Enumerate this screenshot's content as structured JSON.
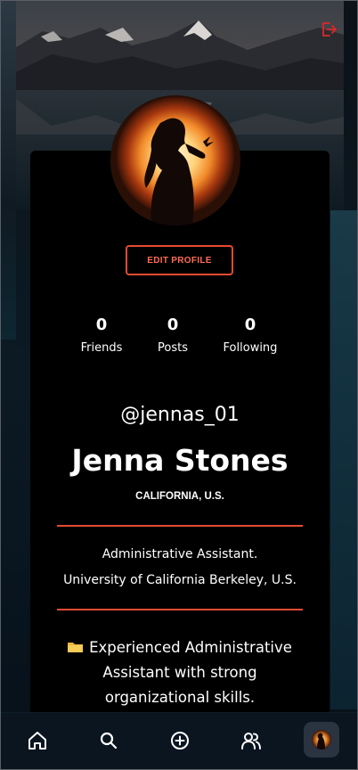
{
  "profile": {
    "edit_label": "EDIT PROFILE",
    "handle": "@jennas_01",
    "name": "Jenna Stones",
    "location": "CALIFORNIA, U.S.",
    "role_line1": "Administrative Assistant.",
    "role_line2": "University of California Berkeley, U.S.",
    "bio_line1": "Experienced Administrative",
    "bio_line2": "Assistant with strong",
    "bio_line3": "organizational skills."
  },
  "stats": [
    {
      "count": "0",
      "label": "Friends"
    },
    {
      "count": "0",
      "label": "Posts"
    },
    {
      "count": "0",
      "label": "Following"
    }
  ],
  "icons": {
    "logout": "logout-icon",
    "bio": "folder-icon",
    "nav": [
      "home-icon",
      "search-icon",
      "add-icon",
      "friends-icon",
      "profile-avatar"
    ]
  },
  "colors": {
    "accent": "#e64a33",
    "background": "#000000",
    "nav_background": "#0a1520"
  }
}
